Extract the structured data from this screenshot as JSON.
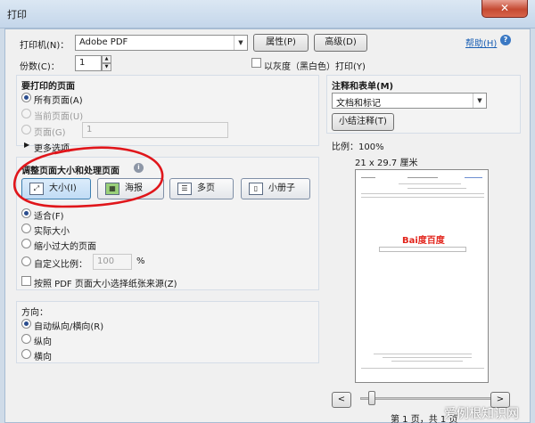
{
  "window": {
    "title": "打印",
    "close_glyph": "✕"
  },
  "printer": {
    "label": "打印机(N)：",
    "value": "Adobe PDF",
    "properties_button": "属性(P)",
    "advanced_button": "高级(D)",
    "help_link": "帮助(H)",
    "help_icon": "?"
  },
  "copies": {
    "label": "份数(C)：",
    "value": "1",
    "grayscale_label": "以灰度（黑白色）打印(Y)"
  },
  "pages_to_print": {
    "title": "要打印的页面",
    "options": [
      "所有页面(A)",
      "当前页面(U)",
      "页面(G)"
    ],
    "pages_value": "1",
    "more_options": "更多选项"
  },
  "sizing": {
    "title": "调整页面大小和处理页面",
    "info_icon": "i",
    "modes": [
      "大小(I)",
      "海报",
      "多页",
      "小册子"
    ],
    "options": [
      "适合(F)",
      "实际大小",
      "缩小过大的页面",
      "自定义比例："
    ],
    "custom_scale_value": "100",
    "percent": "%",
    "paper_source_label": "按照 PDF 页面大小选择纸张来源(Z)"
  },
  "orientation": {
    "title": "方向：",
    "options": [
      "自动纵向/横向(R)",
      "纵向",
      "横向"
    ]
  },
  "comments": {
    "title": "注释和表单(M)",
    "value": "文档和标记",
    "summary_button": "小结注释(T)"
  },
  "preview": {
    "scale": "比例：100%",
    "paper_size": "21 x 29.7 厘米",
    "logo_text": "Bai度百度",
    "prev_button": "<",
    "next_button": ">",
    "page_status": "第 1 页，共 1 页"
  },
  "watermark": "爱例根知识网",
  "colors": {
    "accent": "#3a78c3",
    "annotation_red": "#e0161b",
    "baidu_red": "#e2231a",
    "baidu_blue": "#2932e1"
  }
}
